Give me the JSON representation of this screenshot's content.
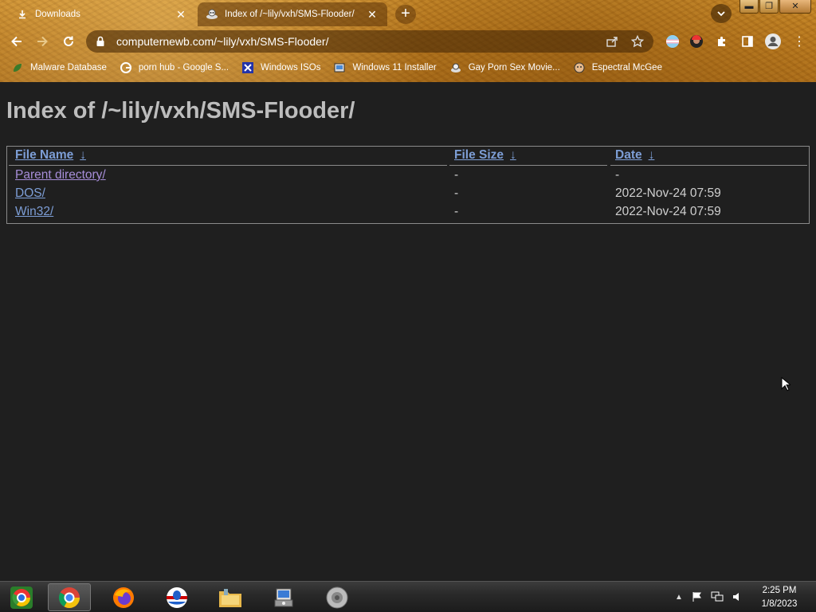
{
  "browser": {
    "tabs": [
      {
        "title": "Downloads",
        "icon": "download-icon",
        "active": false
      },
      {
        "title": "Index of /~lily/vxh/SMS-Flooder/",
        "icon": "site-favicon",
        "active": true
      }
    ],
    "address": "computernewb.com/~lily/vxh/SMS-Flooder/",
    "bookmarks": [
      {
        "label": "Malware Database",
        "icon": "leaf-icon"
      },
      {
        "label": "porn hub - Google S...",
        "icon": "google-icon"
      },
      {
        "label": "Windows ISOs",
        "icon": "x-icon"
      },
      {
        "label": "Windows 11 Installer",
        "icon": "installer-icon"
      },
      {
        "label": "Gay Porn Sex Movie...",
        "icon": "site-favicon"
      },
      {
        "label": "Espectral McGee",
        "icon": "face-icon"
      }
    ],
    "theme_color": "#b8781e"
  },
  "page": {
    "heading": "Index of /~lily/vxh/SMS-Flooder/",
    "columns": {
      "name": "File Name",
      "size": "File Size",
      "date": "Date",
      "sort_arrow": "↓"
    },
    "rows": [
      {
        "name": "Parent directory/",
        "size": "-",
        "date": "-"
      },
      {
        "name": "DOS/",
        "size": "-",
        "date": "2022-Nov-24 07:59"
      },
      {
        "name": "Win32/",
        "size": "-",
        "date": "2022-Nov-24 07:59"
      }
    ]
  },
  "taskbar": {
    "apps": [
      "chrome-alt-icon",
      "chrome-icon",
      "firefox-icon",
      "opera-icon",
      "file-explorer-icon",
      "installer-icon",
      "speaker-app-icon"
    ],
    "clock": {
      "time": "2:25 PM",
      "date": "1/8/2023"
    }
  }
}
